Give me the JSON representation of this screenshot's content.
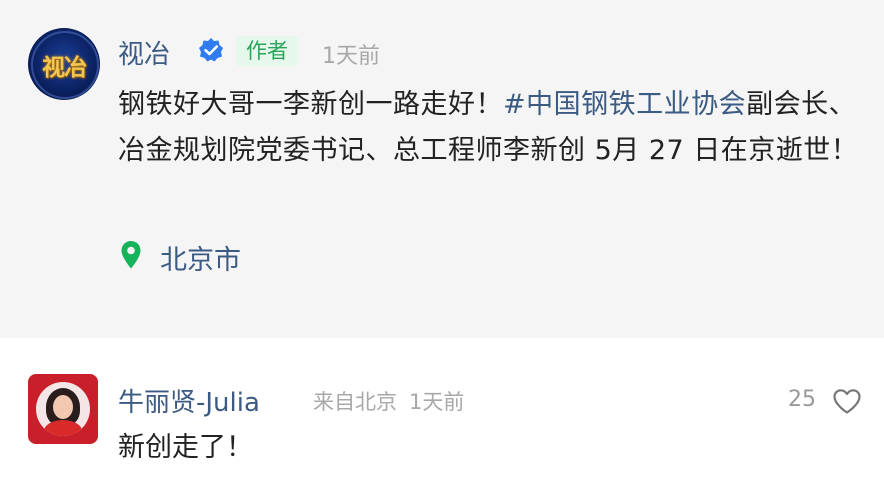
{
  "post": {
    "author_logo_text": "视冶",
    "author_name": "视冶",
    "author_badge": "作者",
    "time": "1天前",
    "content_plain": "钢铁好大哥一李新创一路走好！",
    "content_hashtag": "#中国钢铁工业协会",
    "content_rest": "副会长、冶金规划院党委书记、总工程师李新创 5月 27 日在京逝世！",
    "location": "北京市"
  },
  "comment": {
    "commenter_name": "牛丽贤-Julia",
    "origin": "来自北京",
    "time": "1天前",
    "like_count": "25",
    "text": "新创走了！"
  },
  "colors": {
    "link_blue": "#3b5b84",
    "badge_green": "#2aa55a",
    "badge_bg": "#e6f7ec",
    "location_green": "#16b35a",
    "verified_blue": "#2f7bf0",
    "post_bg": "#f5f5f5"
  },
  "icons": {
    "verified": "verified-check-icon",
    "location": "location-pin-icon",
    "like": "heart-outline-icon"
  }
}
